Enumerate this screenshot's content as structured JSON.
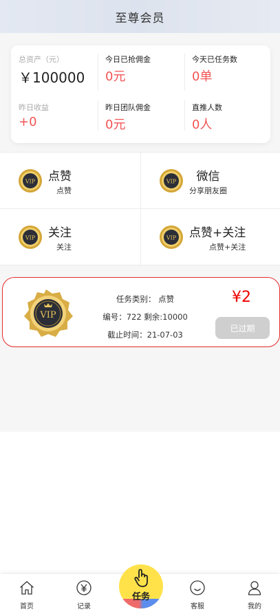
{
  "header": {
    "title": "至尊会员"
  },
  "stats": [
    {
      "label": "总资产（元）",
      "value": "￥100000"
    },
    {
      "label": "今日已抢佣金",
      "value": "0元"
    },
    {
      "label": "今天已任务数",
      "value": "0单"
    },
    {
      "label": "昨日收益",
      "value": "+0"
    },
    {
      "label": "昨日团队佣金",
      "value": "0元"
    },
    {
      "label": "直推人数",
      "value": "0人"
    }
  ],
  "menu": [
    {
      "title": "点赞",
      "subtitle": "点赞"
    },
    {
      "title": "微信",
      "subtitle": "分享朋友圈"
    },
    {
      "title": "关注",
      "subtitle": "关注"
    },
    {
      "title": "点赞+关注",
      "subtitle": "点赞+关注"
    }
  ],
  "task": {
    "badge_text": "VIP",
    "category": "任务类别：  点赞",
    "number_remaining": "编号：722 剩余:10000",
    "deadline": "截止时间：21-07-03",
    "price": "¥2",
    "status_button": "已过期"
  },
  "tabbar": {
    "home": "首页",
    "records": "记录",
    "task": "任务",
    "service": "客服",
    "mine": "我的"
  },
  "colors": {
    "accent_red": "#f25454",
    "price_red": "#e00000",
    "center_yellow": "#ffe24a",
    "expired_gray": "#cfcfcf"
  }
}
